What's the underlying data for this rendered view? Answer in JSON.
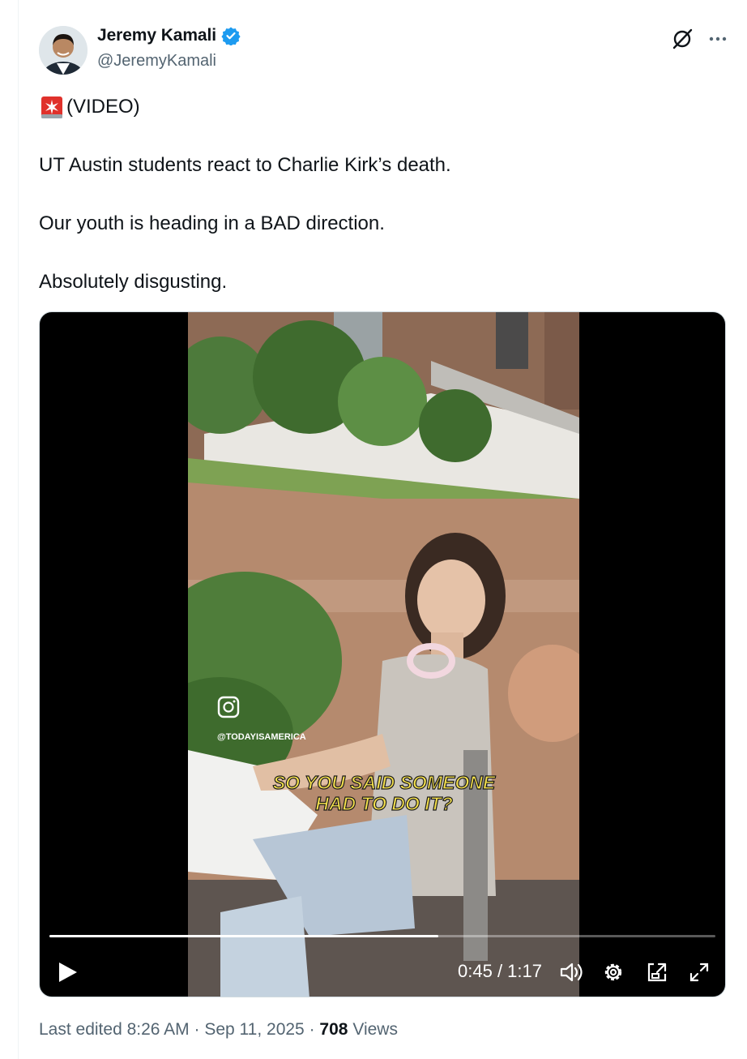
{
  "tweet": {
    "author_name": "Jeremy Kamali",
    "author_handle": "@JeremyKamali",
    "video_tag": "(VIDEO)",
    "lines": [
      "UT Austin students react to Charlie Kirk’s death.",
      "Our youth is heading in a BAD direction.",
      "Absolutely disgusting."
    ],
    "icons": {
      "verified": "verified-badge-icon",
      "grok": "grok-icon",
      "more": "more-icon",
      "siren": "siren-emoji-icon"
    }
  },
  "video": {
    "watermark": "@TODAYISAMERICA",
    "caption_line1": "SO YOU SAID SOMEONE",
    "caption_line2": "HAD TO DO IT?",
    "current_time": "0:45",
    "total_time": "1:17",
    "time_separator": " / ",
    "progress": 0.584
  },
  "meta": {
    "edited_label": "Last edited",
    "time": "8:26 AM",
    "dot": "·",
    "date": "Sep 11, 2025",
    "views_count": "708",
    "views_label": "Views"
  },
  "colors": {
    "verified_blue": "#1d9bf0",
    "text_secondary": "#536471"
  }
}
